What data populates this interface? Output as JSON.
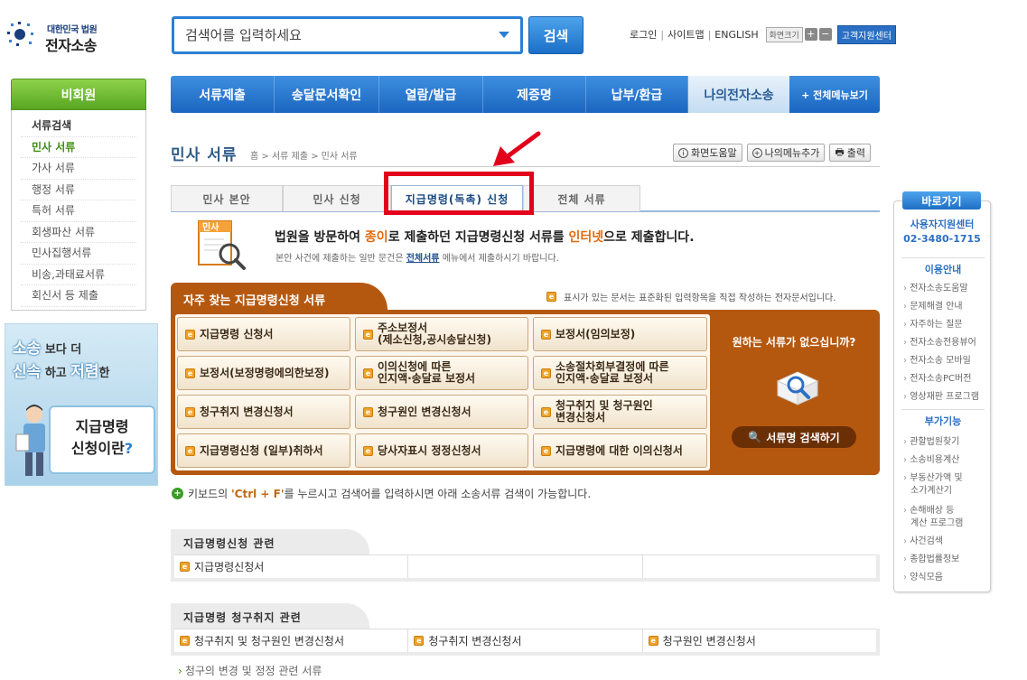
{
  "logo": {
    "small": "대한민국 법원",
    "big": "전자소송"
  },
  "search": {
    "placeholder": "검색어를 입력하세요",
    "button": "검색"
  },
  "util": {
    "login": "로그인",
    "sitemap": "사이트맵",
    "english": "ENGLISH",
    "zoom": "화면크기",
    "plus": "+",
    "minus": "−",
    "support": "고객지원센터"
  },
  "nav": {
    "items": [
      "서류제출",
      "송달문서확인",
      "열람/발급",
      "제증명",
      "납부/환급",
      "나의전자소송"
    ],
    "all": "+ 전체메뉴보기"
  },
  "sidebar": {
    "header": "비회원",
    "items": [
      "서류검색",
      "민사 서류",
      "가사 서류",
      "행정 서류",
      "특허 서류",
      "회생파산 서류",
      "민사집행서류",
      "비송,과태료서류",
      "회신서 등 제출"
    ]
  },
  "promo": {
    "l1a": "소송",
    "l1b": "보다 더",
    "l2a": "신속",
    "l2b": "하고",
    "l2c": "저렴",
    "l2d": "한",
    "card1": "지급명령",
    "card2": "신청이란",
    "q": "?"
  },
  "page": {
    "title": "민사 서류",
    "breadcrumb": "홈 > 서류 제출 > 민사 서류",
    "tools": [
      "화면도움말",
      "나의메뉴추가",
      "출력"
    ]
  },
  "tabs": [
    "민사 본안",
    "민사 신청",
    "지급명령(독촉) 신청",
    "전체 서류"
  ],
  "intro": {
    "icon_label": "민사",
    "main_a": "법원을 방문하여 ",
    "main_b": "종이",
    "main_c": "로 제출하던 지급명령신청 서류를 ",
    "main_d": "인터넷",
    "main_e": "으로 제출합니다.",
    "sub_a": "본안 사건에 제출하는 일반 문건은 ",
    "sub_link": "전체서류",
    "sub_b": " 메뉴에서 제출하시기 바랍니다."
  },
  "panel": {
    "title": "자주 찾는 지급명령신청 서류",
    "note": "표시가 있는 문서는 표준화된 입력항목을 직접 작성하는 전자문서입니다.",
    "forms": [
      [
        "지급명령 신청서",
        "주소보정서\n(제소신청,공시송달신청)",
        "보정서(임의보정)"
      ],
      [
        "보정서(보정명령에의한보정)",
        "이의신청에 따른\n인지액·송달료 보정서",
        "소송절차회부결정에 따른\n인지액·송달료 보정서"
      ],
      [
        "청구취지 변경신청서",
        "청구원인 변경신청서",
        "청구취지 및 청구원인\n변경신청서"
      ],
      [
        "지급명령신청 (일부)취하서",
        "당사자표시 정정신청서",
        "지급명령에 대한 이의신청서"
      ]
    ],
    "not_found": "원하는 서류가 없으십니까?",
    "search_button": "서류명 검색하기"
  },
  "hint": {
    "a": "키보드의 ",
    "key": "'Ctrl + F'",
    "b": "를 누르시고 검색어를 입력하시면 아래 소송서류 검색이 가능합니다."
  },
  "related": [
    {
      "title": "지급명령신청 관련",
      "cells": [
        "지급명령신청서",
        "",
        ""
      ]
    },
    {
      "title": "지급명령 청구취지 관련",
      "cells": [
        "청구취지 및 청구원인 변경신청서",
        "청구취지 변경신청서",
        "청구원인 변경신청서"
      ]
    }
  ],
  "more": "청구의 변경 및 정정 관련 서류",
  "quick": {
    "header": "바로가기",
    "center1": "사용자지원센터",
    "center2": "02-3480-1715",
    "sec1": "이용안내",
    "sec1_items": [
      "전자소송도움말",
      "문제해결 안내",
      "자주하는 질문",
      "전자소송전용뷰어",
      "전자소송 모바일",
      "전자소송PC버전",
      "영상재판 프로그램"
    ],
    "sec2": "부가기능",
    "sec2_items": [
      "관할법원찾기",
      "소송비용계산",
      "부동산가액 및",
      "소가계산기",
      "손해배상 등",
      "계산 프로그램",
      "사건검색",
      "종합법률정보",
      "양식모음"
    ]
  }
}
